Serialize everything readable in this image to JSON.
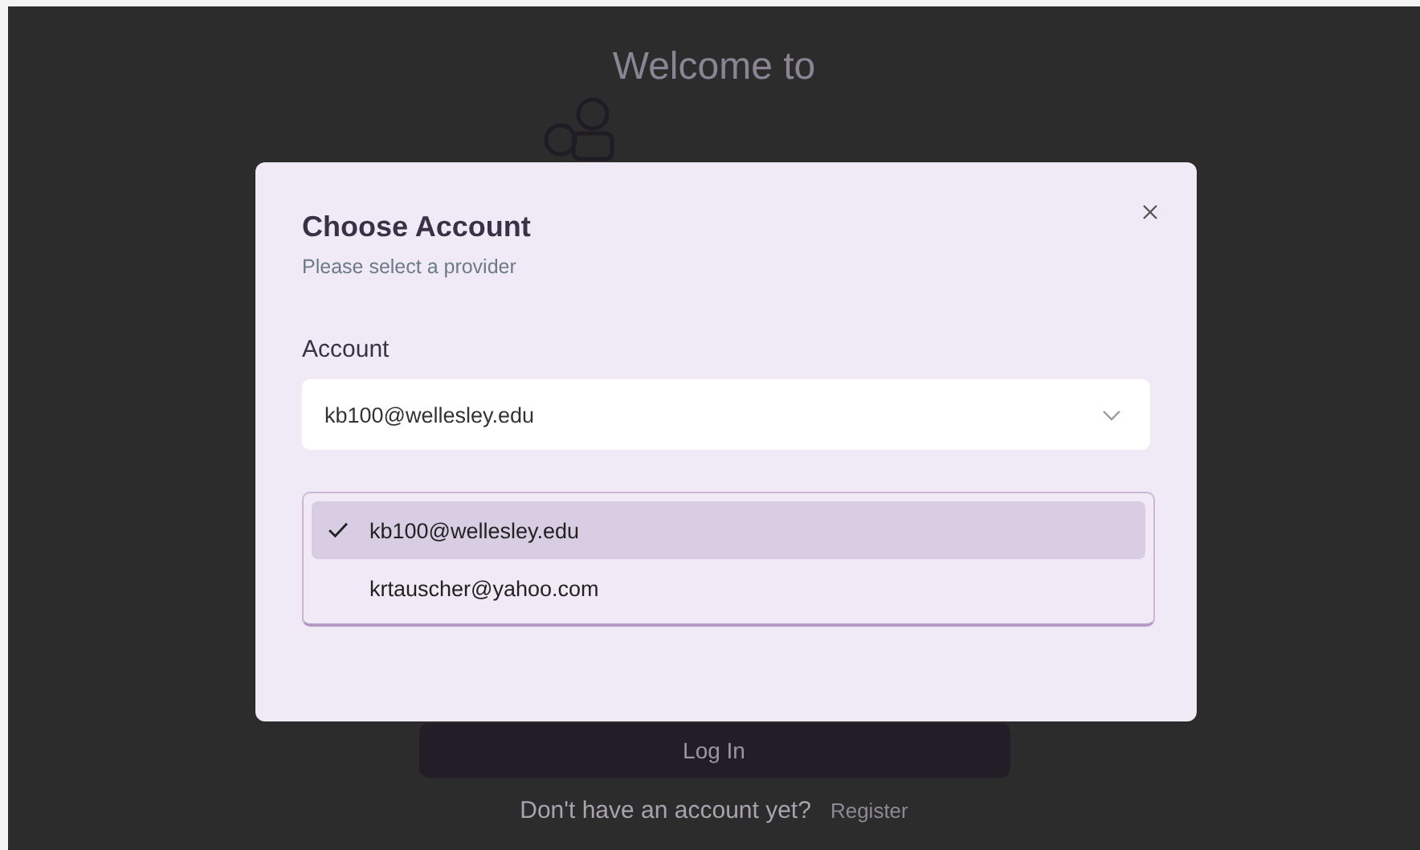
{
  "background": {
    "heading": "Welcome to",
    "login_button": "Log In",
    "register_prompt": "Don't have an account yet?",
    "register_link": "Register"
  },
  "dialog": {
    "title": "Choose Account",
    "subtitle": "Please select a provider",
    "field_label": "Account",
    "value": "kb100@wellesley.edu",
    "expanded": true,
    "options": [
      {
        "label": "kb100@wellesley.edu",
        "selected": true
      },
      {
        "label": "krtauscher@yahoo.com",
        "selected": false
      }
    ]
  }
}
